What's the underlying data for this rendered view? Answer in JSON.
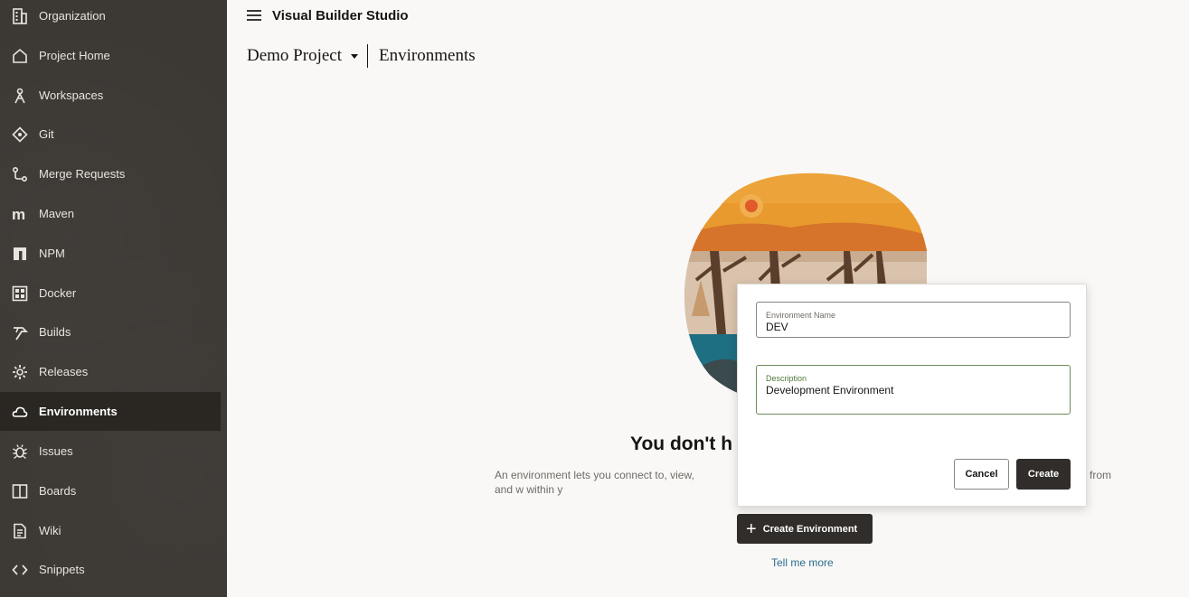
{
  "sidebar": {
    "items": [
      {
        "label": "Organization",
        "icon": "building-icon"
      },
      {
        "label": "Project Home",
        "icon": "home-icon"
      },
      {
        "label": "Workspaces",
        "icon": "workspace-icon"
      },
      {
        "label": "Git",
        "icon": "git-icon"
      },
      {
        "label": "Merge Requests",
        "icon": "merge-request-icon"
      },
      {
        "label": "Maven",
        "icon": "maven-icon"
      },
      {
        "label": "NPM",
        "icon": "npm-icon"
      },
      {
        "label": "Docker",
        "icon": "docker-icon"
      },
      {
        "label": "Builds",
        "icon": "builds-icon"
      },
      {
        "label": "Releases",
        "icon": "gear-icon"
      },
      {
        "label": "Environments",
        "icon": "cloud-icon",
        "active": true
      },
      {
        "label": "Issues",
        "icon": "bug-icon"
      },
      {
        "label": "Boards",
        "icon": "board-icon"
      },
      {
        "label": "Wiki",
        "icon": "document-icon"
      },
      {
        "label": "Snippets",
        "icon": "code-icon"
      }
    ]
  },
  "header": {
    "app_title": "Visual Builder Studio",
    "project_name": "Demo Project",
    "page_title": "Environments"
  },
  "empty_state": {
    "heading": "You don't h",
    "description_left": "An environment lets you connect to, view, and w within y",
    "description_right": "from",
    "create_button": "Create Environment",
    "tell_more_link": "Tell me more"
  },
  "dialog": {
    "name_label": "Environment Name",
    "name_value": "DEV",
    "description_label": "Description",
    "description_value": "Development Environment",
    "cancel_label": "Cancel",
    "create_label": "Create"
  },
  "colors": {
    "sidebar_bg": "#3c3834",
    "sidebar_active": "#2a2622",
    "primary_button": "#312d2a",
    "link": "#2b6c8e",
    "focus_border": "#6b8a59"
  }
}
